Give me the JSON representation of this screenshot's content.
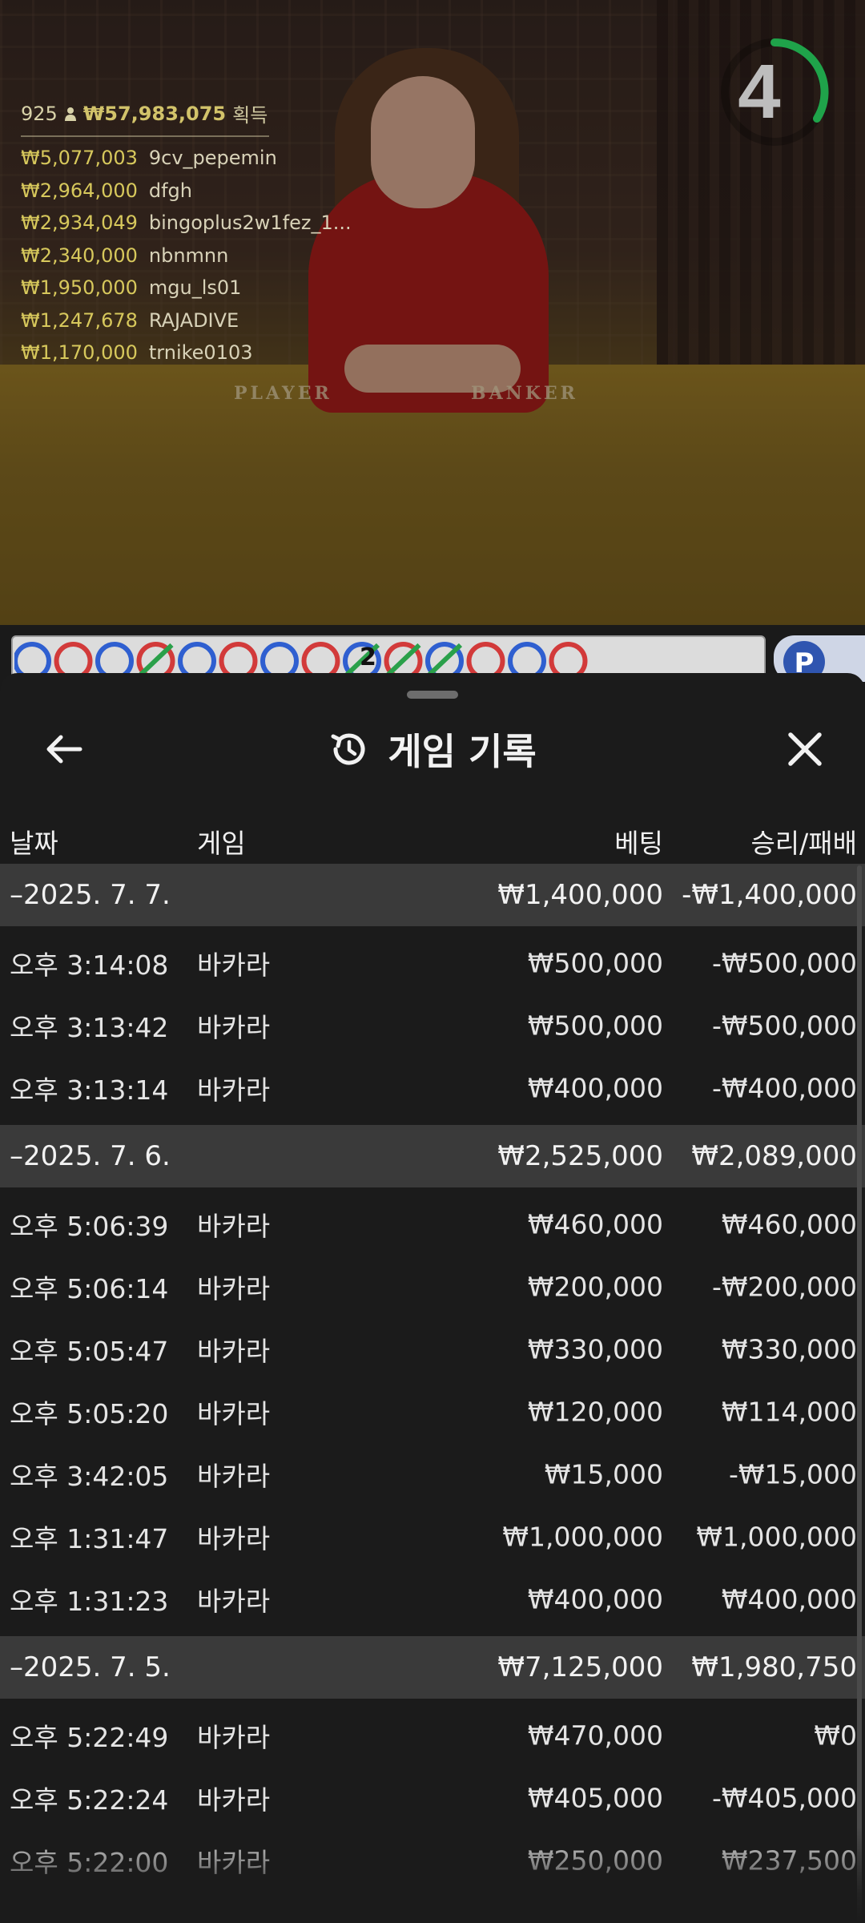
{
  "video": {
    "felt_player": "PLAYER",
    "felt_banker": "BANKER",
    "timer": "4",
    "winners_header": {
      "count": "925",
      "total": "₩57,983,075",
      "label": "획득"
    },
    "winners": [
      {
        "amount": "₩5,077,003",
        "name": "9cv_pepemin"
      },
      {
        "amount": "₩2,964,000",
        "name": "dfgh"
      },
      {
        "amount": "₩2,934,049",
        "name": "bingoplus2w1fez_1..."
      },
      {
        "amount": "₩2,340,000",
        "name": "nbnmnn"
      },
      {
        "amount": "₩1,950,000",
        "name": "mgu_ls01"
      },
      {
        "amount": "₩1,247,678",
        "name": "RAJADIVE"
      },
      {
        "amount": "₩1,170,000",
        "name": "trnike0103"
      }
    ]
  },
  "road": {
    "badge": "2",
    "right_label": "P",
    "colors": {
      "player": "#2f5fd0",
      "banker": "#d23a3a",
      "tie": "#2aa04a"
    }
  },
  "sheet": {
    "title": "게임 기록",
    "columns": {
      "date": "날짜",
      "game": "게임",
      "bet": "베팅",
      "winloss": "승리/패배"
    },
    "groups": [
      {
        "date": "–2025. 7. 7.",
        "bet": "₩1,400,000",
        "winloss": "-₩1,400,000",
        "rows": [
          {
            "time": "오후 3:14:08",
            "game": "바카라",
            "bet": "₩500,000",
            "winloss": "-₩500,000"
          },
          {
            "time": "오후 3:13:42",
            "game": "바카라",
            "bet": "₩500,000",
            "winloss": "-₩500,000"
          },
          {
            "time": "오후 3:13:14",
            "game": "바카라",
            "bet": "₩400,000",
            "winloss": "-₩400,000"
          }
        ]
      },
      {
        "date": "–2025. 7. 6.",
        "bet": "₩2,525,000",
        "winloss": "₩2,089,000",
        "rows": [
          {
            "time": "오후 5:06:39",
            "game": "바카라",
            "bet": "₩460,000",
            "winloss": "₩460,000"
          },
          {
            "time": "오후 5:06:14",
            "game": "바카라",
            "bet": "₩200,000",
            "winloss": "-₩200,000"
          },
          {
            "time": "오후 5:05:47",
            "game": "바카라",
            "bet": "₩330,000",
            "winloss": "₩330,000"
          },
          {
            "time": "오후 5:05:20",
            "game": "바카라",
            "bet": "₩120,000",
            "winloss": "₩114,000"
          },
          {
            "time": "오후 3:42:05",
            "game": "바카라",
            "bet": "₩15,000",
            "winloss": "-₩15,000"
          },
          {
            "time": "오후 1:31:47",
            "game": "바카라",
            "bet": "₩1,000,000",
            "winloss": "₩1,000,000"
          },
          {
            "time": "오후 1:31:23",
            "game": "바카라",
            "bet": "₩400,000",
            "winloss": "₩400,000"
          }
        ]
      },
      {
        "date": "–2025. 7. 5.",
        "bet": "₩7,125,000",
        "winloss": "₩1,980,750",
        "rows": [
          {
            "time": "오후 5:22:49",
            "game": "바카라",
            "bet": "₩470,000",
            "winloss": "₩0"
          },
          {
            "time": "오후 5:22:24",
            "game": "바카라",
            "bet": "₩405,000",
            "winloss": "-₩405,000"
          },
          {
            "time": "오후 5:22:00",
            "game": "바카라",
            "bet": "₩250,000",
            "winloss": "₩237,500"
          }
        ]
      }
    ]
  }
}
